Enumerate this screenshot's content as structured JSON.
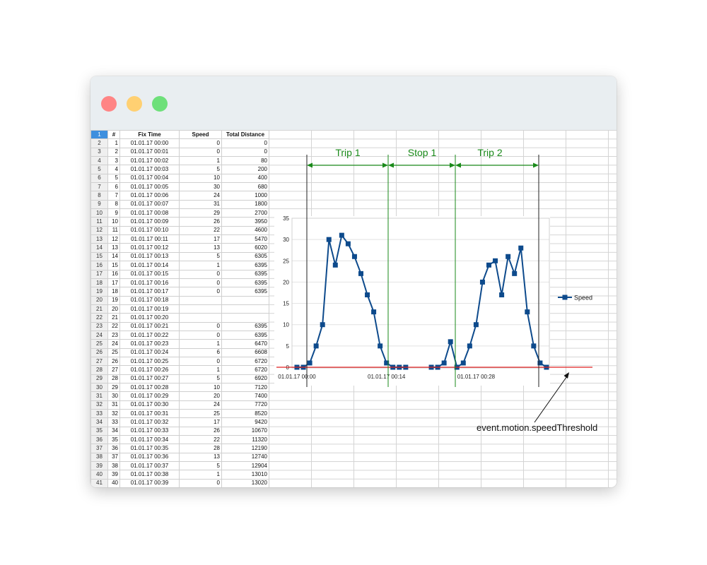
{
  "table": {
    "headers": [
      "#",
      "Fix Time",
      "Speed",
      "Total Distance"
    ],
    "selected_row_header": "1",
    "rows": [
      {
        "r": "2",
        "n": "1",
        "time": "01.01.17 00:00",
        "speed": "0",
        "dist": "0"
      },
      {
        "r": "3",
        "n": "2",
        "time": "01.01.17 00:01",
        "speed": "0",
        "dist": "0"
      },
      {
        "r": "4",
        "n": "3",
        "time": "01.01.17 00:02",
        "speed": "1",
        "dist": "80"
      },
      {
        "r": "5",
        "n": "4",
        "time": "01.01.17 00:03",
        "speed": "5",
        "dist": "200"
      },
      {
        "r": "6",
        "n": "5",
        "time": "01.01.17 00:04",
        "speed": "10",
        "dist": "400"
      },
      {
        "r": "7",
        "n": "6",
        "time": "01.01.17 00:05",
        "speed": "30",
        "dist": "680"
      },
      {
        "r": "8",
        "n": "7",
        "time": "01.01.17 00:06",
        "speed": "24",
        "dist": "1000"
      },
      {
        "r": "9",
        "n": "8",
        "time": "01.01.17 00:07",
        "speed": "31",
        "dist": "1800"
      },
      {
        "r": "10",
        "n": "9",
        "time": "01.01.17 00:08",
        "speed": "29",
        "dist": "2700"
      },
      {
        "r": "11",
        "n": "10",
        "time": "01.01.17 00:09",
        "speed": "26",
        "dist": "3950"
      },
      {
        "r": "12",
        "n": "11",
        "time": "01.01.17 00:10",
        "speed": "22",
        "dist": "4600"
      },
      {
        "r": "13",
        "n": "12",
        "time": "01.01.17 00:11",
        "speed": "17",
        "dist": "5470"
      },
      {
        "r": "14",
        "n": "13",
        "time": "01.01.17 00:12",
        "speed": "13",
        "dist": "6020"
      },
      {
        "r": "15",
        "n": "14",
        "time": "01.01.17 00:13",
        "speed": "5",
        "dist": "6305"
      },
      {
        "r": "16",
        "n": "15",
        "time": "01.01.17 00:14",
        "speed": "1",
        "dist": "6395"
      },
      {
        "r": "17",
        "n": "16",
        "time": "01.01.17 00:15",
        "speed": "0",
        "dist": "6395"
      },
      {
        "r": "18",
        "n": "17",
        "time": "01.01.17 00:16",
        "speed": "0",
        "dist": "6395"
      },
      {
        "r": "19",
        "n": "18",
        "time": "01.01.17 00:17",
        "speed": "0",
        "dist": "6395"
      },
      {
        "r": "20",
        "n": "19",
        "time": "01.01.17 00:18",
        "speed": "",
        "dist": ""
      },
      {
        "r": "21",
        "n": "20",
        "time": "01.01.17 00:19",
        "speed": "",
        "dist": ""
      },
      {
        "r": "22",
        "n": "21",
        "time": "01.01.17 00:20",
        "speed": "",
        "dist": ""
      },
      {
        "r": "23",
        "n": "22",
        "time": "01.01.17 00:21",
        "speed": "0",
        "dist": "6395"
      },
      {
        "r": "24",
        "n": "23",
        "time": "01.01.17 00:22",
        "speed": "0",
        "dist": "6395"
      },
      {
        "r": "25",
        "n": "24",
        "time": "01.01.17 00:23",
        "speed": "1",
        "dist": "6470"
      },
      {
        "r": "26",
        "n": "25",
        "time": "01.01.17 00:24",
        "speed": "6",
        "dist": "6608"
      },
      {
        "r": "27",
        "n": "26",
        "time": "01.01.17 00:25",
        "speed": "0",
        "dist": "6720"
      },
      {
        "r": "28",
        "n": "27",
        "time": "01.01.17 00:26",
        "speed": "1",
        "dist": "6720"
      },
      {
        "r": "29",
        "n": "28",
        "time": "01.01.17 00:27",
        "speed": "5",
        "dist": "6920"
      },
      {
        "r": "30",
        "n": "29",
        "time": "01.01.17 00:28",
        "speed": "10",
        "dist": "7120"
      },
      {
        "r": "31",
        "n": "30",
        "time": "01.01.17 00:29",
        "speed": "20",
        "dist": "7400"
      },
      {
        "r": "32",
        "n": "31",
        "time": "01.01.17 00:30",
        "speed": "24",
        "dist": "7720"
      },
      {
        "r": "33",
        "n": "32",
        "time": "01.01.17 00:31",
        "speed": "25",
        "dist": "8520"
      },
      {
        "r": "34",
        "n": "33",
        "time": "01.01.17 00:32",
        "speed": "17",
        "dist": "9420"
      },
      {
        "r": "35",
        "n": "34",
        "time": "01.01.17 00:33",
        "speed": "26",
        "dist": "10670"
      },
      {
        "r": "36",
        "n": "35",
        "time": "01.01.17 00:34",
        "speed": "22",
        "dist": "11320"
      },
      {
        "r": "37",
        "n": "36",
        "time": "01.01.17 00:35",
        "speed": "28",
        "dist": "12190"
      },
      {
        "r": "38",
        "n": "37",
        "time": "01.01.17 00:36",
        "speed": "13",
        "dist": "12740"
      },
      {
        "r": "39",
        "n": "38",
        "time": "01.01.17 00:37",
        "speed": "5",
        "dist": "12904"
      },
      {
        "r": "40",
        "n": "39",
        "time": "01.01.17 00:38",
        "speed": "1",
        "dist": "13010"
      },
      {
        "r": "41",
        "n": "40",
        "time": "01.01.17 00:39",
        "speed": "0",
        "dist": "13020"
      }
    ]
  },
  "annotations": {
    "trip1": "Trip 1",
    "stop1": "Stop 1",
    "trip2": "Trip 2",
    "threshold": "event.motion.speedThreshold",
    "trip_color": "#1a8a1a",
    "threshold_color": "#e02020"
  },
  "chart_data": {
    "type": "line",
    "series": [
      {
        "name": "Speed",
        "color": "#0d4a8c",
        "values": [
          0,
          0,
          1,
          5,
          10,
          30,
          24,
          31,
          29,
          26,
          22,
          17,
          13,
          5,
          1,
          0,
          0,
          0,
          null,
          null,
          null,
          0,
          0,
          1,
          6,
          0,
          1,
          5,
          10,
          20,
          24,
          25,
          17,
          26,
          22,
          28,
          13,
          5,
          1,
          0
        ]
      }
    ],
    "x_tick_labels": [
      {
        "index": 0,
        "label": "01.01.17 00:00"
      },
      {
        "index": 14,
        "label": "01.01.17 00:14"
      },
      {
        "index": 28,
        "label": "01.01.17 00:28"
      }
    ],
    "ylim": [
      0,
      35
    ],
    "yticks": [
      0,
      5,
      10,
      15,
      20,
      25,
      30,
      35
    ],
    "legend": "right",
    "grid": true
  }
}
